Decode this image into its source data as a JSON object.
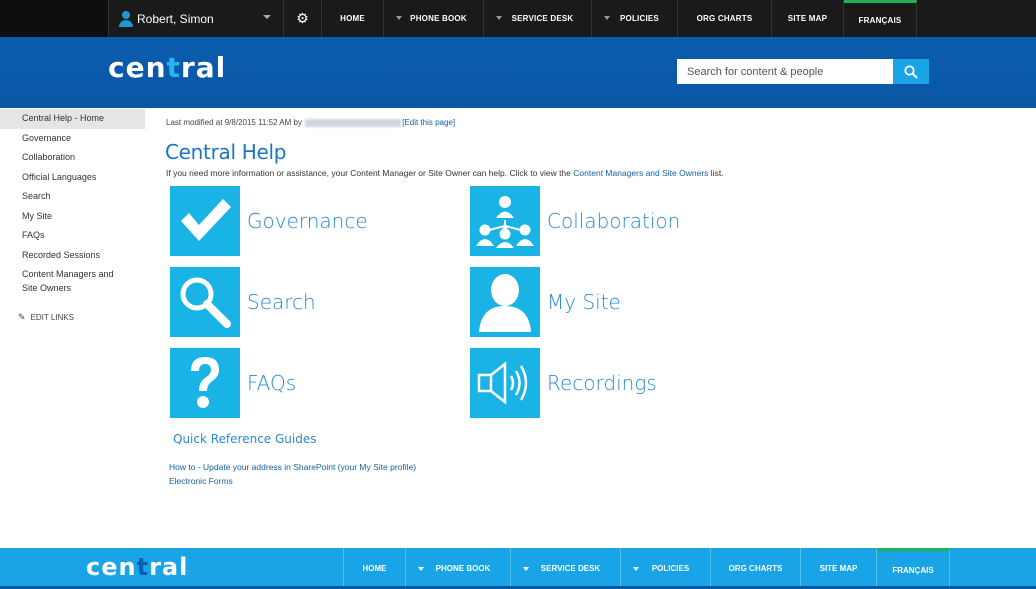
{
  "user": {
    "name": "Robert, Simon"
  },
  "topnav": [
    {
      "label": "HOME",
      "dropdown": false
    },
    {
      "label": "PHONE BOOK",
      "dropdown": true
    },
    {
      "label": "SERVICE DESK",
      "dropdown": true
    },
    {
      "label": "POLICIES",
      "dropdown": true
    },
    {
      "label": "ORG CHARTS",
      "dropdown": false
    },
    {
      "label": "SITE MAP",
      "dropdown": false
    },
    {
      "label": "FRANÇAIS",
      "dropdown": false
    }
  ],
  "brand": {
    "prefix": "cen",
    "dot": "t",
    "suffix": "ral"
  },
  "search": {
    "placeholder": "Search for content & people"
  },
  "leftnav": {
    "items": [
      "Central Help - Home",
      "Governance",
      "Collaboration",
      "Official Languages",
      "Search",
      "My Site",
      "FAQs",
      "Recorded Sessions",
      "Content Managers and Site Owners"
    ],
    "edit_links": "EDIT LINKS"
  },
  "main": {
    "modified_prefix": "Last modified at 9/8/2015 11:52 AM by",
    "edit_page": "[Edit this page]",
    "title": "Central Help",
    "intro_text": "If you need more information or assistance, your Content Manager or Site Owner can help. Click to view the",
    "intro_link": "Content Managers and Site Owners",
    "intro_suffix": "list.",
    "tiles": [
      {
        "label": "Governance",
        "icon": "checkmark-icon"
      },
      {
        "label": "Collaboration",
        "icon": "people-network-icon"
      },
      {
        "label": "Search",
        "icon": "magnifier-icon"
      },
      {
        "label": "My Site",
        "icon": "person-icon"
      },
      {
        "label": "FAQs",
        "icon": "question-mark-icon"
      },
      {
        "label": "Recordings",
        "icon": "speaker-icon"
      }
    ],
    "quick_reference": "Quick Reference Guides",
    "links": [
      "How to - Update your address in SharePoint (your My Site profile)",
      "Electronic Forms"
    ]
  },
  "colors": {
    "header_blue": "#0b5db0",
    "tile_blue": "#19b3e6",
    "footer_blue": "#1aa4e8",
    "accent_green": "#1fb256"
  }
}
